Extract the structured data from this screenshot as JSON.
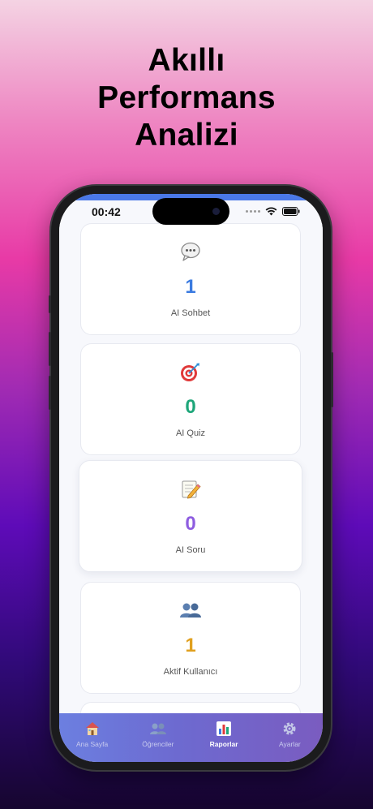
{
  "headline": {
    "line1": "Akıllı",
    "line2": "Performans",
    "line3": "Analizi"
  },
  "status": {
    "time": "00:42"
  },
  "cards": [
    {
      "value": "1",
      "label": "AI Sohbet",
      "icon": "speech-bubble-icon",
      "color": "#3b7be0"
    },
    {
      "value": "0",
      "label": "AI Quiz",
      "icon": "dart-target-icon",
      "color": "#1ea67a"
    },
    {
      "value": "0",
      "label": "AI Soru",
      "icon": "memo-pencil-icon",
      "color": "#8e5de0"
    },
    {
      "value": "1",
      "label": "Aktif Kullanıcı",
      "icon": "users-icon",
      "color": "#e0a01f"
    }
  ],
  "tabs": [
    {
      "label": "Ana Sayfa",
      "icon": "house-icon",
      "active": false
    },
    {
      "label": "Öğrenciler",
      "icon": "users-icon",
      "active": false
    },
    {
      "label": "Raporlar",
      "icon": "bar-chart-icon",
      "active": true
    },
    {
      "label": "Ayarlar",
      "icon": "gear-icon",
      "active": false
    }
  ]
}
